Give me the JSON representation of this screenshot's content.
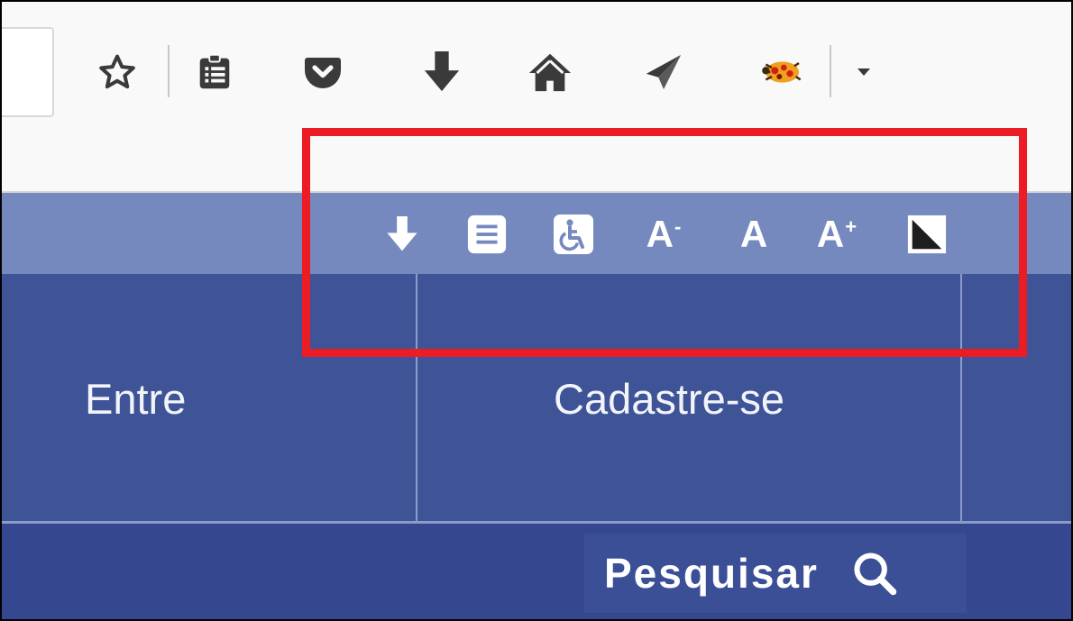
{
  "toolbar": {
    "icons": [
      "star-icon",
      "reading-list-icon",
      "pocket-icon",
      "download-icon",
      "home-icon",
      "send-icon",
      "bug-addon-icon",
      "dropdown-arrow-icon"
    ]
  },
  "accessibility_bar": {
    "icons": [
      "skip-to-content-icon",
      "content-list-icon",
      "accessibility-icon",
      "font-decrease-icon",
      "font-normal-icon",
      "font-increase-icon",
      "contrast-icon"
    ],
    "font_decrease_label": "A",
    "font_decrease_sup": "-",
    "font_normal_label": "A",
    "font_increase_label": "A",
    "font_increase_sup": "+"
  },
  "nav": {
    "items": [
      {
        "label": "Entre"
      },
      {
        "label": "Cadastre-se"
      }
    ]
  },
  "search": {
    "label": "Pesquisar"
  },
  "colors": {
    "a11y_bar": "#7589bf",
    "nav_bg": "#3f5497",
    "search_bg": "#34478f",
    "highlight": "#ec1c24"
  }
}
